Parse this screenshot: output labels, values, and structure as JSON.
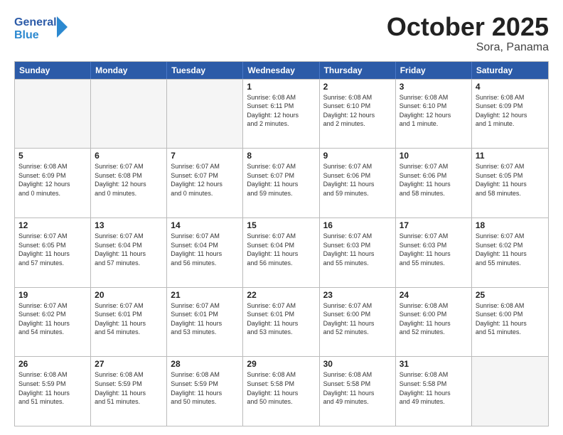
{
  "header": {
    "logo_general": "General",
    "logo_blue": "Blue",
    "title": "October 2025",
    "subtitle": "Sora, Panama"
  },
  "weekdays": [
    "Sunday",
    "Monday",
    "Tuesday",
    "Wednesday",
    "Thursday",
    "Friday",
    "Saturday"
  ],
  "weeks": [
    [
      {
        "day": "",
        "info": "",
        "empty": true
      },
      {
        "day": "",
        "info": "",
        "empty": true
      },
      {
        "day": "",
        "info": "",
        "empty": true
      },
      {
        "day": "1",
        "info": "Sunrise: 6:08 AM\nSunset: 6:11 PM\nDaylight: 12 hours\nand 2 minutes.",
        "empty": false
      },
      {
        "day": "2",
        "info": "Sunrise: 6:08 AM\nSunset: 6:10 PM\nDaylight: 12 hours\nand 2 minutes.",
        "empty": false
      },
      {
        "day": "3",
        "info": "Sunrise: 6:08 AM\nSunset: 6:10 PM\nDaylight: 12 hours\nand 1 minute.",
        "empty": false
      },
      {
        "day": "4",
        "info": "Sunrise: 6:08 AM\nSunset: 6:09 PM\nDaylight: 12 hours\nand 1 minute.",
        "empty": false
      }
    ],
    [
      {
        "day": "5",
        "info": "Sunrise: 6:08 AM\nSunset: 6:09 PM\nDaylight: 12 hours\nand 0 minutes.",
        "empty": false
      },
      {
        "day": "6",
        "info": "Sunrise: 6:07 AM\nSunset: 6:08 PM\nDaylight: 12 hours\nand 0 minutes.",
        "empty": false
      },
      {
        "day": "7",
        "info": "Sunrise: 6:07 AM\nSunset: 6:07 PM\nDaylight: 12 hours\nand 0 minutes.",
        "empty": false
      },
      {
        "day": "8",
        "info": "Sunrise: 6:07 AM\nSunset: 6:07 PM\nDaylight: 11 hours\nand 59 minutes.",
        "empty": false
      },
      {
        "day": "9",
        "info": "Sunrise: 6:07 AM\nSunset: 6:06 PM\nDaylight: 11 hours\nand 59 minutes.",
        "empty": false
      },
      {
        "day": "10",
        "info": "Sunrise: 6:07 AM\nSunset: 6:06 PM\nDaylight: 11 hours\nand 58 minutes.",
        "empty": false
      },
      {
        "day": "11",
        "info": "Sunrise: 6:07 AM\nSunset: 6:05 PM\nDaylight: 11 hours\nand 58 minutes.",
        "empty": false
      }
    ],
    [
      {
        "day": "12",
        "info": "Sunrise: 6:07 AM\nSunset: 6:05 PM\nDaylight: 11 hours\nand 57 minutes.",
        "empty": false
      },
      {
        "day": "13",
        "info": "Sunrise: 6:07 AM\nSunset: 6:04 PM\nDaylight: 11 hours\nand 57 minutes.",
        "empty": false
      },
      {
        "day": "14",
        "info": "Sunrise: 6:07 AM\nSunset: 6:04 PM\nDaylight: 11 hours\nand 56 minutes.",
        "empty": false
      },
      {
        "day": "15",
        "info": "Sunrise: 6:07 AM\nSunset: 6:04 PM\nDaylight: 11 hours\nand 56 minutes.",
        "empty": false
      },
      {
        "day": "16",
        "info": "Sunrise: 6:07 AM\nSunset: 6:03 PM\nDaylight: 11 hours\nand 55 minutes.",
        "empty": false
      },
      {
        "day": "17",
        "info": "Sunrise: 6:07 AM\nSunset: 6:03 PM\nDaylight: 11 hours\nand 55 minutes.",
        "empty": false
      },
      {
        "day": "18",
        "info": "Sunrise: 6:07 AM\nSunset: 6:02 PM\nDaylight: 11 hours\nand 55 minutes.",
        "empty": false
      }
    ],
    [
      {
        "day": "19",
        "info": "Sunrise: 6:07 AM\nSunset: 6:02 PM\nDaylight: 11 hours\nand 54 minutes.",
        "empty": false
      },
      {
        "day": "20",
        "info": "Sunrise: 6:07 AM\nSunset: 6:01 PM\nDaylight: 11 hours\nand 54 minutes.",
        "empty": false
      },
      {
        "day": "21",
        "info": "Sunrise: 6:07 AM\nSunset: 6:01 PM\nDaylight: 11 hours\nand 53 minutes.",
        "empty": false
      },
      {
        "day": "22",
        "info": "Sunrise: 6:07 AM\nSunset: 6:01 PM\nDaylight: 11 hours\nand 53 minutes.",
        "empty": false
      },
      {
        "day": "23",
        "info": "Sunrise: 6:07 AM\nSunset: 6:00 PM\nDaylight: 11 hours\nand 52 minutes.",
        "empty": false
      },
      {
        "day": "24",
        "info": "Sunrise: 6:08 AM\nSunset: 6:00 PM\nDaylight: 11 hours\nand 52 minutes.",
        "empty": false
      },
      {
        "day": "25",
        "info": "Sunrise: 6:08 AM\nSunset: 6:00 PM\nDaylight: 11 hours\nand 51 minutes.",
        "empty": false
      }
    ],
    [
      {
        "day": "26",
        "info": "Sunrise: 6:08 AM\nSunset: 5:59 PM\nDaylight: 11 hours\nand 51 minutes.",
        "empty": false
      },
      {
        "day": "27",
        "info": "Sunrise: 6:08 AM\nSunset: 5:59 PM\nDaylight: 11 hours\nand 51 minutes.",
        "empty": false
      },
      {
        "day": "28",
        "info": "Sunrise: 6:08 AM\nSunset: 5:59 PM\nDaylight: 11 hours\nand 50 minutes.",
        "empty": false
      },
      {
        "day": "29",
        "info": "Sunrise: 6:08 AM\nSunset: 5:58 PM\nDaylight: 11 hours\nand 50 minutes.",
        "empty": false
      },
      {
        "day": "30",
        "info": "Sunrise: 6:08 AM\nSunset: 5:58 PM\nDaylight: 11 hours\nand 49 minutes.",
        "empty": false
      },
      {
        "day": "31",
        "info": "Sunrise: 6:08 AM\nSunset: 5:58 PM\nDaylight: 11 hours\nand 49 minutes.",
        "empty": false
      },
      {
        "day": "",
        "info": "",
        "empty": true
      }
    ]
  ]
}
